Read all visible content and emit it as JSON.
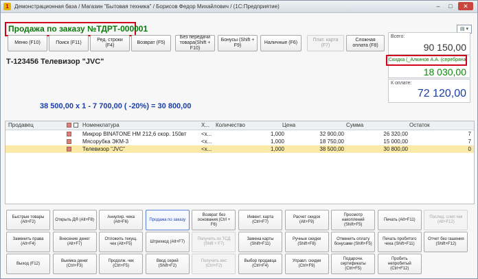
{
  "window": {
    "title": "Демонстрационная база / Магазин \"Бытовая техника\" / Борисов Федор Михайлович / (1С:Предприятие)",
    "min": "–",
    "max": "□",
    "close": "✕"
  },
  "document": {
    "title": "Продажа по заказу №ТДРТ-000001",
    "menu_icon": "▤ ▾"
  },
  "toolbar": [
    {
      "label": "Меню (F10)",
      "disabled": false
    },
    {
      "label": "Поиск (F11)",
      "disabled": false
    },
    {
      "label": "Ред. строки (F4)",
      "disabled": false
    },
    {
      "label": "Возврат (F5)",
      "disabled": false
    },
    {
      "label": "Без передачи товара(Shift + F10)",
      "disabled": false
    },
    {
      "label": "Бонусы (Shift + F9)",
      "disabled": false
    },
    {
      "label": "Наличные (F6)",
      "disabled": false
    },
    {
      "label": "Плат. карта (F7)",
      "disabled": true
    },
    {
      "label": "Сложная оплата (F8)",
      "disabled": false
    }
  ],
  "product": {
    "name": "Т-123456 Телевизор \"JVC\"",
    "calc": "38 500,00  x 1  - 7 700,00  ( -20%)  = 30 800,00"
  },
  "totals": {
    "total_label": "Всего:",
    "total_value": "90 150,00",
    "discount_label": "Скидка (_Алкинов А.А. (серебряная)):",
    "discount_value": "18 030,00",
    "to_pay_label": "К оплате:",
    "to_pay_value": "72 120,00"
  },
  "grid": {
    "headers": {
      "seller": "Продавец",
      "item": "Номенклатура",
      "x": "Х...",
      "qty": "Количество",
      "price": "Цена",
      "sum": "Сумма",
      "rest": "Остаток"
    },
    "rows": [
      {
        "item": "Микрор BINATONE HM 212,6 скор. 150вт",
        "x": "<х...",
        "qty": "1,000",
        "price": "32 900,00",
        "sum": "26 320,00",
        "rest": "7",
        "selected": false
      },
      {
        "item": "Мясорубка ЭКМ-3",
        "x": "<х...",
        "qty": "1,000",
        "price": "18 750,00",
        "sum": "15 000,00",
        "rest": "7",
        "selected": false
      },
      {
        "item": "Телевизор \"JVC\"",
        "x": "<х...",
        "qty": "1,000",
        "price": "38 500,00",
        "sum": "30 800,00",
        "rest": "0",
        "selected": true
      }
    ]
  },
  "bottom_buttons": [
    [
      {
        "label": "Быстрые товары (Alt+F2)"
      },
      {
        "label": "Открыть ДЯ (Alt+F8)"
      },
      {
        "label": "Аннулир. чека (Alt+F6)"
      },
      {
        "label": "Продажа по заказу",
        "active": true
      },
      {
        "label": "Возврат без основания (Ctrl + F6)"
      },
      {
        "label": "Инвент. карта (Ctrl+F7)"
      },
      {
        "label": "Расчет скидок (Alt+F9)"
      },
      {
        "label": "Просмотр накоплений (Shift+F5)"
      },
      {
        "label": "Печать (Alt+F11)"
      },
      {
        "label": "Послед. слип чек (Alt+F12)",
        "disabled": true
      }
    ],
    [
      {
        "label": "Заменить права (Alt+F4)"
      },
      {
        "label": "Внесение денег (Alt+F7)"
      },
      {
        "label": "Отложить текущ. чек (Alt+F5)"
      },
      {
        "label": "Штрихкод (Alt+F7)"
      },
      {
        "label": "Получить из ТСД (Shift + F7)",
        "disabled": true
      },
      {
        "label": "Замена карты (Shift+F11)"
      },
      {
        "label": "Ручные скидки (Shift+F8)"
      },
      {
        "label": "Отменить оплату бонусами (Shift+F5)"
      },
      {
        "label": "Печать пробитого чека (Shift+F11)"
      },
      {
        "label": "Отчет без гашения (Shift+F12)"
      }
    ],
    [
      {
        "label": "Выход (F12)"
      },
      {
        "label": "Выемка денег (Ctrl+F3)"
      },
      {
        "label": "Продолж. чек (Ctrl+F5)"
      },
      {
        "label": "Ввод серий (Shift+F2)"
      },
      {
        "label": "Получить вес (Ctrl+F2)",
        "disabled": true
      },
      {
        "label": "Выбор продавца (Ctrl+F4)"
      },
      {
        "label": "Управл. скидки (Ctrl+F9)"
      },
      {
        "label": "Подарочн. сертификаты (Ctrl+F5)"
      },
      {
        "label": "Пробить непробитый (Ctrl+F12)"
      }
    ]
  ]
}
